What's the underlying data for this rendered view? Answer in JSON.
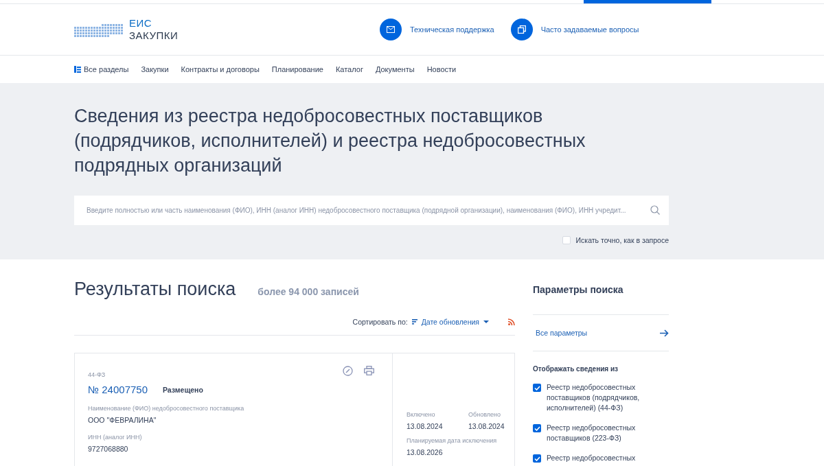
{
  "header": {
    "logo_line1": "ЕИС",
    "logo_line2": "ЗАКУПКИ",
    "links": [
      {
        "kind": "mail",
        "label": "Техническая поддержка"
      },
      {
        "kind": "faq",
        "label": "Часто задаваемые вопросы"
      }
    ]
  },
  "nav": [
    "Все разделы",
    "Закупки",
    "Контракты и договоры",
    "Планирование",
    "Каталог",
    "Документы",
    "Новости"
  ],
  "page_title": "Сведения из реестра недобросовестных поставщиков (подрядчиков, исполнителей) и реестра недобросовестных подрядных организаций",
  "search": {
    "placeholder": "Введите полностью или часть наименования (ФИО), ИНН (аналог ИНН) недобросовестного поставщика (подрядной организации), наименования (ФИО), ИНН учредит...",
    "exact": {
      "label": "Искать точно, как в запросе",
      "checked": false
    }
  },
  "results": {
    "title": "Результаты поиска",
    "count": "более 94 000 записей",
    "sort_label": "Сортировать по:",
    "sort_value": "Дате обновления"
  },
  "records": [
    {
      "law": "44-ФЗ",
      "number": "№ 24007750",
      "status": "Размещено",
      "fields": [
        {
          "label": "Наименование (ФИО) недобросовестного поставщика",
          "value": "ООО \"ФЕВРАЛИНА\""
        },
        {
          "label": "ИНН (аналог ИНН)",
          "value": "9727068880"
        }
      ],
      "dates": [
        {
          "label": "Включено",
          "value": "13.08.2024"
        },
        {
          "label": "Обновлено",
          "value": "13.08.2024"
        },
        {
          "label": "Планируемая дата исключения",
          "value": "13.08.2026"
        }
      ]
    }
  ],
  "sidebar": {
    "title": "Параметры поиска",
    "all_params": "Все параметры",
    "show_from": "Отображать сведения из",
    "sources": [
      {
        "label": "Реестр недобросовестных поставщиков (подрядчиков, исполнителей) (44-ФЗ)",
        "checked": true
      },
      {
        "label": "Реестр недобросовестных поставщиков (223-ФЗ)",
        "checked": true
      },
      {
        "label": "Реестр недобросовестных",
        "checked": true
      }
    ]
  }
}
